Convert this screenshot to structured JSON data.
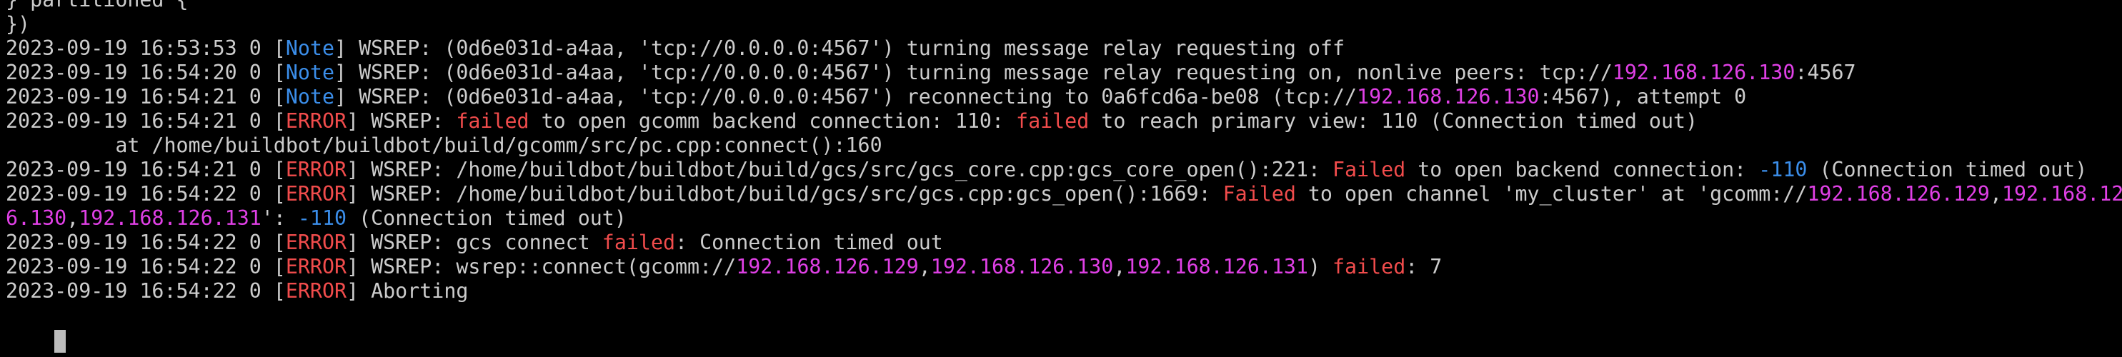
{
  "terminal": {
    "lines": [
      [
        {
          "t": "} partitioned {"
        }
      ],
      [
        {
          "t": "})"
        }
      ],
      [
        {
          "t": "2023-09-19 16:53:53 0 ["
        },
        {
          "t": "Note",
          "c": "note"
        },
        {
          "t": "] WSREP: (0d6e031d-a4aa, 'tcp://0.0.0.0:4567') turning message relay requesting off"
        }
      ],
      [
        {
          "t": "2023-09-19 16:54:20 0 ["
        },
        {
          "t": "Note",
          "c": "note"
        },
        {
          "t": "] WSREP: (0d6e031d-a4aa, 'tcp://0.0.0.0:4567') turning message relay requesting on, nonlive peers: tcp://"
        },
        {
          "t": "192.168.126.130",
          "c": "ip"
        },
        {
          "t": ":4567"
        }
      ],
      [
        {
          "t": "2023-09-19 16:54:21 0 ["
        },
        {
          "t": "Note",
          "c": "note"
        },
        {
          "t": "] WSREP: (0d6e031d-a4aa, 'tcp://0.0.0.0:4567') reconnecting to 0a6fcd6a-be08 (tcp://"
        },
        {
          "t": "192.168.126.130",
          "c": "ip"
        },
        {
          "t": ":4567), attempt 0"
        }
      ],
      [
        {
          "t": "2023-09-19 16:54:21 0 ["
        },
        {
          "t": "ERROR",
          "c": "error"
        },
        {
          "t": "] WSREP: "
        },
        {
          "t": "failed",
          "c": "error"
        },
        {
          "t": " to open gcomm backend connection: 110: "
        },
        {
          "t": "failed",
          "c": "error"
        },
        {
          "t": " to reach primary view: 110 (Connection timed out)"
        }
      ],
      [
        {
          "t": "         at /home/buildbot/buildbot/build/gcomm/src/pc.cpp:connect():160"
        }
      ],
      [
        {
          "t": "2023-09-19 16:54:21 0 ["
        },
        {
          "t": "ERROR",
          "c": "error"
        },
        {
          "t": "] WSREP: /home/buildbot/buildbot/build/gcs/src/gcs_core.cpp:gcs_core_open():221: "
        },
        {
          "t": "Failed",
          "c": "error"
        },
        {
          "t": " to open backend connection: "
        },
        {
          "t": "-110",
          "c": "num"
        },
        {
          "t": " (Connection timed out)"
        }
      ],
      [
        {
          "t": "2023-09-19 16:54:22 0 ["
        },
        {
          "t": "ERROR",
          "c": "error"
        },
        {
          "t": "] WSREP: /home/buildbot/buildbot/build/gcs/src/gcs.cpp:gcs_open():1669: "
        },
        {
          "t": "Failed",
          "c": "error"
        },
        {
          "t": " to open channel 'my_cluster' at 'gcomm://"
        },
        {
          "t": "192.168.126.129",
          "c": "ip"
        },
        {
          "t": ","
        },
        {
          "t": "192.168.12",
          "c": "ip"
        }
      ],
      [
        {
          "t": "6.130",
          "c": "ip"
        },
        {
          "t": ","
        },
        {
          "t": "192.168.126.131",
          "c": "ip"
        },
        {
          "t": "': "
        },
        {
          "t": "-110",
          "c": "num"
        },
        {
          "t": " (Connection timed out)"
        }
      ],
      [
        {
          "t": "2023-09-19 16:54:22 0 ["
        },
        {
          "t": "ERROR",
          "c": "error"
        },
        {
          "t": "] WSREP: gcs connect "
        },
        {
          "t": "failed",
          "c": "error"
        },
        {
          "t": ": Connection timed out"
        }
      ],
      [
        {
          "t": "2023-09-19 16:54:22 0 ["
        },
        {
          "t": "ERROR",
          "c": "error"
        },
        {
          "t": "] WSREP: wsrep::connect(gcomm://"
        },
        {
          "t": "192.168.126.129",
          "c": "ip"
        },
        {
          "t": ","
        },
        {
          "t": "192.168.126.130",
          "c": "ip"
        },
        {
          "t": ","
        },
        {
          "t": "192.168.126.131",
          "c": "ip"
        },
        {
          "t": ") "
        },
        {
          "t": "failed",
          "c": "error"
        },
        {
          "t": ": 7"
        }
      ],
      [
        {
          "t": "2023-09-19 16:54:22 0 ["
        },
        {
          "t": "ERROR",
          "c": "error"
        },
        {
          "t": "] Aborting"
        }
      ]
    ]
  },
  "colors": {
    "background": "#000000",
    "text": "#cccccc",
    "note": "#3b8eea",
    "error": "#f14c4c",
    "ip": "#e040e6",
    "number": "#3b8eea"
  }
}
